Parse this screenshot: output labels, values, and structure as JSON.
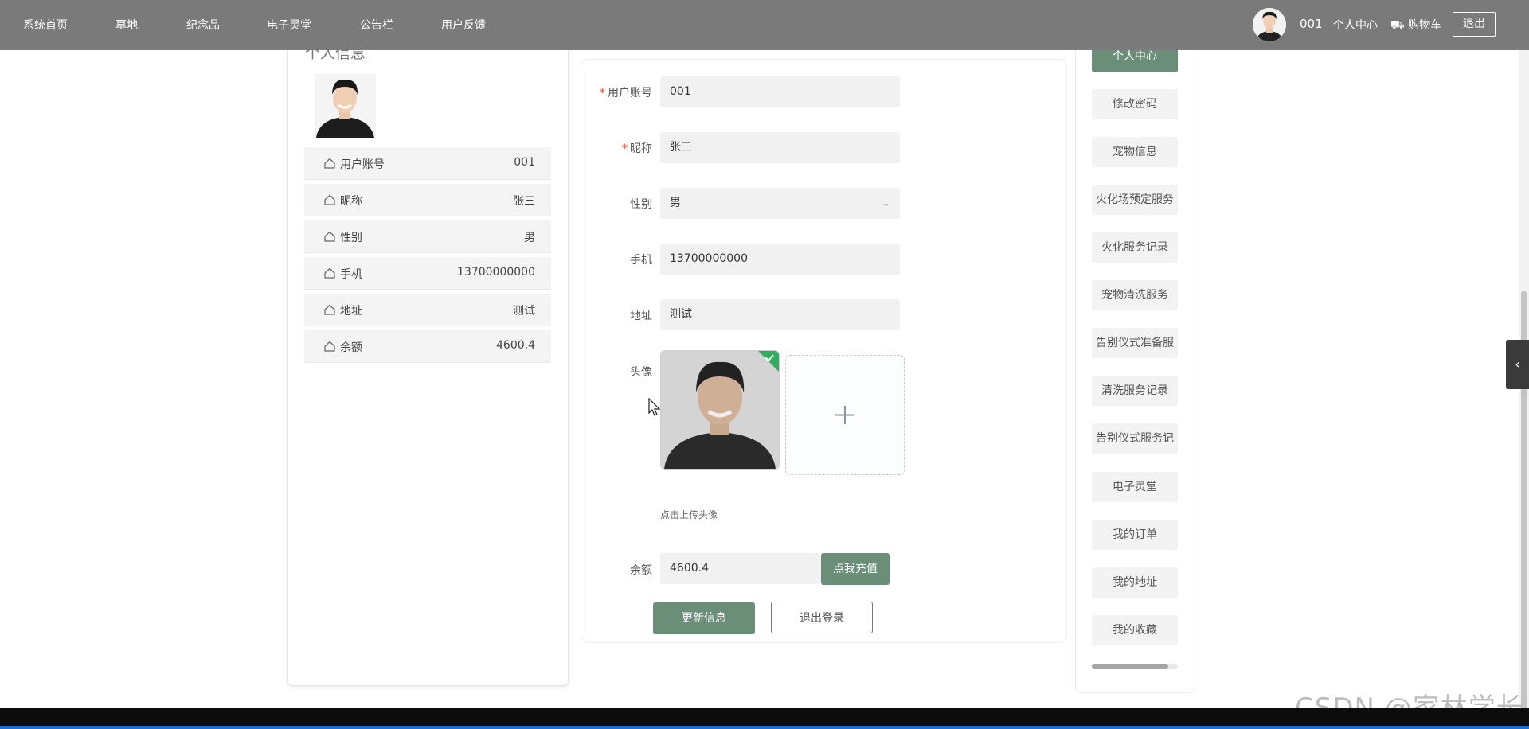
{
  "nav": {
    "items": [
      "系统首页",
      "墓地",
      "纪念品",
      "电子灵堂",
      "公告栏",
      "用户反馈"
    ],
    "username": "001",
    "user_center": "个人中心",
    "cart": "购物车",
    "logout": "退出"
  },
  "profile": {
    "title": "个人信息",
    "rows": [
      {
        "label": "用户账号",
        "value": "001"
      },
      {
        "label": "昵称",
        "value": "张三"
      },
      {
        "label": "性别",
        "value": "男"
      },
      {
        "label": "手机",
        "value": "13700000000"
      },
      {
        "label": "地址",
        "value": "测试"
      },
      {
        "label": "余额",
        "value": "4600.4"
      }
    ]
  },
  "form": {
    "account_label": "用户账号",
    "account_value": "001",
    "nickname_label": "昵称",
    "nickname_value": "张三",
    "gender_label": "性别",
    "gender_value": "男",
    "phone_label": "手机",
    "phone_value": "13700000000",
    "address_label": "地址",
    "address_value": "测试",
    "avatar_label": "头像",
    "upload_hint": "点击上传头像",
    "balance_label": "余额",
    "balance_value": "4600.4",
    "recharge_button": "点我充值",
    "update_button": "更新信息",
    "logout_button": "退出登录"
  },
  "menu": {
    "items": [
      "个人中心",
      "修改密码",
      "宠物信息",
      "火化场预定服务",
      "火化服务记录",
      "宠物清洗服务",
      "告别仪式准备服",
      "清洗服务记录",
      "告别仪式服务记",
      "电子灵堂",
      "我的订单",
      "我的地址",
      "我的收藏"
    ],
    "active_index": 0
  },
  "watermark": "CSDN @家林学长",
  "colors": {
    "accent": "#6b8e79",
    "nav_bg": "#7a7a7a"
  }
}
